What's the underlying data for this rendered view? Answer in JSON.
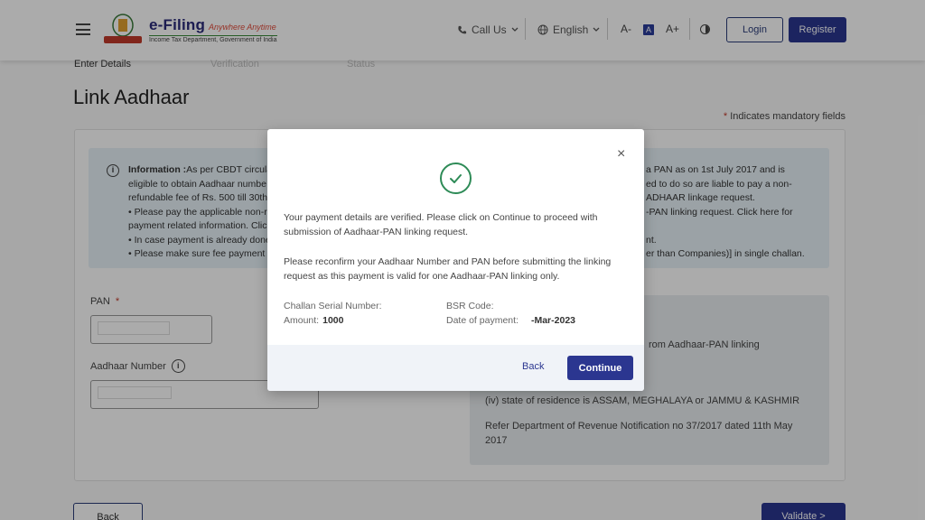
{
  "header": {
    "logo_title": "e-Filing",
    "logo_tagline": "Anywhere Anytime",
    "logo_subtitle": "Income Tax Department, Government of India",
    "call_us": "Call Us",
    "language": "English",
    "font_decrease": "A-",
    "font_normal": "A",
    "font_increase": "A+",
    "login": "Login",
    "register": "Register",
    "icons": [
      "menu-icon",
      "phone-icon",
      "globe-icon",
      "chevron-down-icon",
      "contrast-icon"
    ]
  },
  "steps": [
    "Enter Details",
    "Verification",
    "Status"
  ],
  "page": {
    "title": "Link Aadhaar",
    "mandatory_note": "Indicates mandatory fields",
    "info_label": "Information :",
    "info_left": [
      "As per CBDT circula",
      "eligible to obtain Aadhaar numbe",
      "refundable fee of Rs. 500 till 30th",
      "Please pay the applicable non-ref",
      "payment related information. Clic",
      "In case payment is already done c",
      "Please make sure fee payment is"
    ],
    "info_right": [
      "a PAN as on 1st July 2017 and is",
      "ed to do so are liable to pay a non-",
      "ADHAAR linkage request.",
      "-PAN linking request. Click here for",
      "nt.",
      "er than Companies)] in single challan."
    ],
    "pan_label": "PAN",
    "aadhaar_label": "Aadhaar Number",
    "exemption_lines": [
      "rom Aadhaar-PAN linking",
      "(iv) state of residence is ASSAM, MEGHALAYA or JAMMU & KASHMIR",
      "Refer Department of Revenue Notification no 37/2017 dated 11th May 2017"
    ],
    "back_button": "Back",
    "validate_button": "Validate >"
  },
  "modal": {
    "message_1": "Your payment details are verified. Please click on Continue to proceed with submission of Aadhaar-PAN linking request.",
    "message_2": "Please reconfirm your Aadhaar Number and PAN before submitting the linking request as this payment is valid for one Aadhaar-PAN linking only.",
    "challan_label": "Challan Serial Number:",
    "bsr_label": "BSR Code:",
    "amount_label": "Amount:",
    "amount_value": "1000",
    "date_label": "Date of payment:",
    "date_value": "-Mar-2023",
    "back": "Back",
    "continue": "Continue"
  },
  "colors": {
    "primary": "#2b3690",
    "success": "#2e8b57",
    "info_bg": "#e7f2f8",
    "required": "#c0392b"
  }
}
